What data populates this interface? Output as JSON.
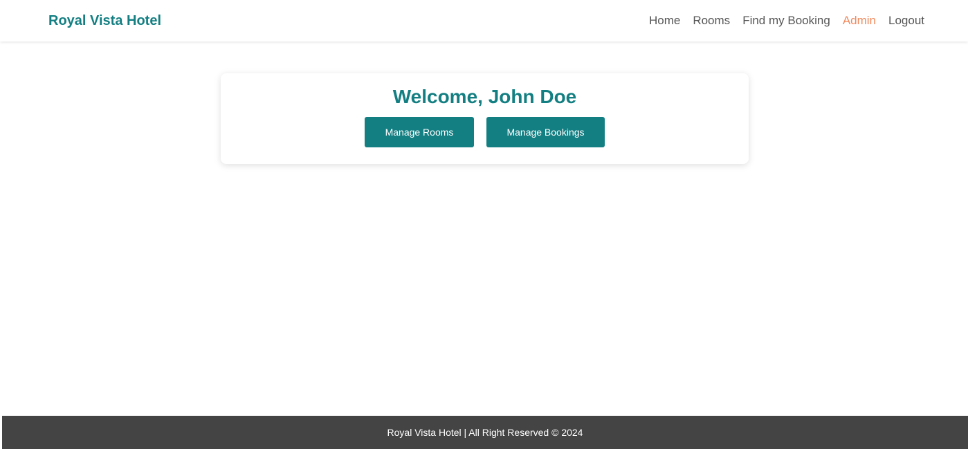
{
  "header": {
    "brand": "Royal Vista Hotel",
    "nav": {
      "home": "Home",
      "rooms": "Rooms",
      "find_booking": "Find my Booking",
      "admin": "Admin",
      "logout": "Logout"
    },
    "active_item": "Admin"
  },
  "main": {
    "welcome": "Welcome, John Doe",
    "buttons": {
      "manage_rooms": "Manage Rooms",
      "manage_bookings": "Manage Bookings"
    }
  },
  "footer": {
    "text": "Royal Vista Hotel | All Right Reserved © 2024"
  },
  "colors": {
    "primary": "#137f82",
    "active_nav": "#f08a5d",
    "footer_bg": "#444444"
  }
}
